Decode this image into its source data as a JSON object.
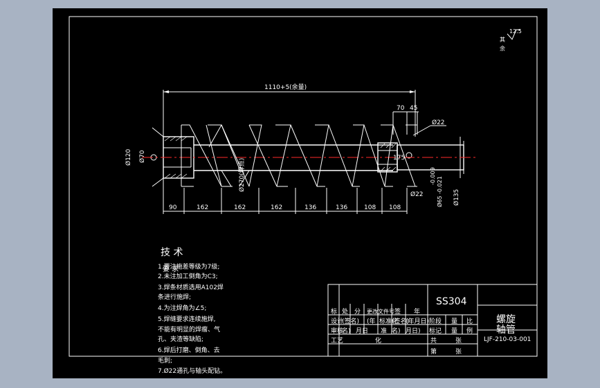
{
  "drawing": {
    "overall_length": "1110+5(余量)",
    "dims_top_right": [
      "70",
      "45"
    ],
    "hole_dia": "Ø22",
    "left_dia_outer": "Ø120",
    "left_dia_inner": "Ø70",
    "center_label": "Ø270(焊点)",
    "right_inner": "175",
    "right_hole2": "Ø22",
    "right_dia": "Ø135",
    "tolerance_line1": "-0.009",
    "tolerance_line2": "Ø65 -0.021",
    "segment_dims": [
      "90",
      "162",
      "162",
      "162",
      "136",
      "136",
      "108",
      "108"
    ]
  },
  "roughness": {
    "value": "12.5",
    "label_line1": "其",
    "label_line2": "余"
  },
  "notes": {
    "title": "技 术",
    "overlay_title": "要 求",
    "lines": [
      "1.要注施差等级为7级;",
      "2.未注加工倒角为C3;",
      "3.焊条材质选用A102焊",
      "条进行施焊;",
      "4.为注焊角为∠5;",
      "5.焊缝要求连续施焊,",
      "不能有明显的焊瘤、气",
      "孔、夹渣等缺陷;",
      "6.焊后打磨、倒角、去",
      "毛刺;",
      "7.Ø22通孔与轴头配钻。"
    ]
  },
  "title_block": {
    "material": "SS304",
    "part_name_line1": "螺旋",
    "part_name_line2": "轴管",
    "drawing_no": "LJF-210-03-001",
    "headers": [
      "标",
      "处",
      "分",
      "更改文件号",
      "签",
      "年"
    ],
    "row2": [
      "设计",
      "(签名)",
      "(年",
      "标准化",
      "(签名)",
      "(年月日)"
    ],
    "row3": [
      "审核",
      "名)",
      "月日",
      "准",
      "名)",
      "月日)"
    ],
    "row4": [
      "工艺",
      "",
      "",
      "化",
      "",
      ""
    ],
    "stage_labels": [
      "阶段",
      "量",
      "比"
    ],
    "stage_row2": [
      "标记",
      "量",
      "例"
    ],
    "sheets_total": "共",
    "sheets_label": "张",
    "sheet_no": "第",
    "sheet_no_label": "张"
  }
}
